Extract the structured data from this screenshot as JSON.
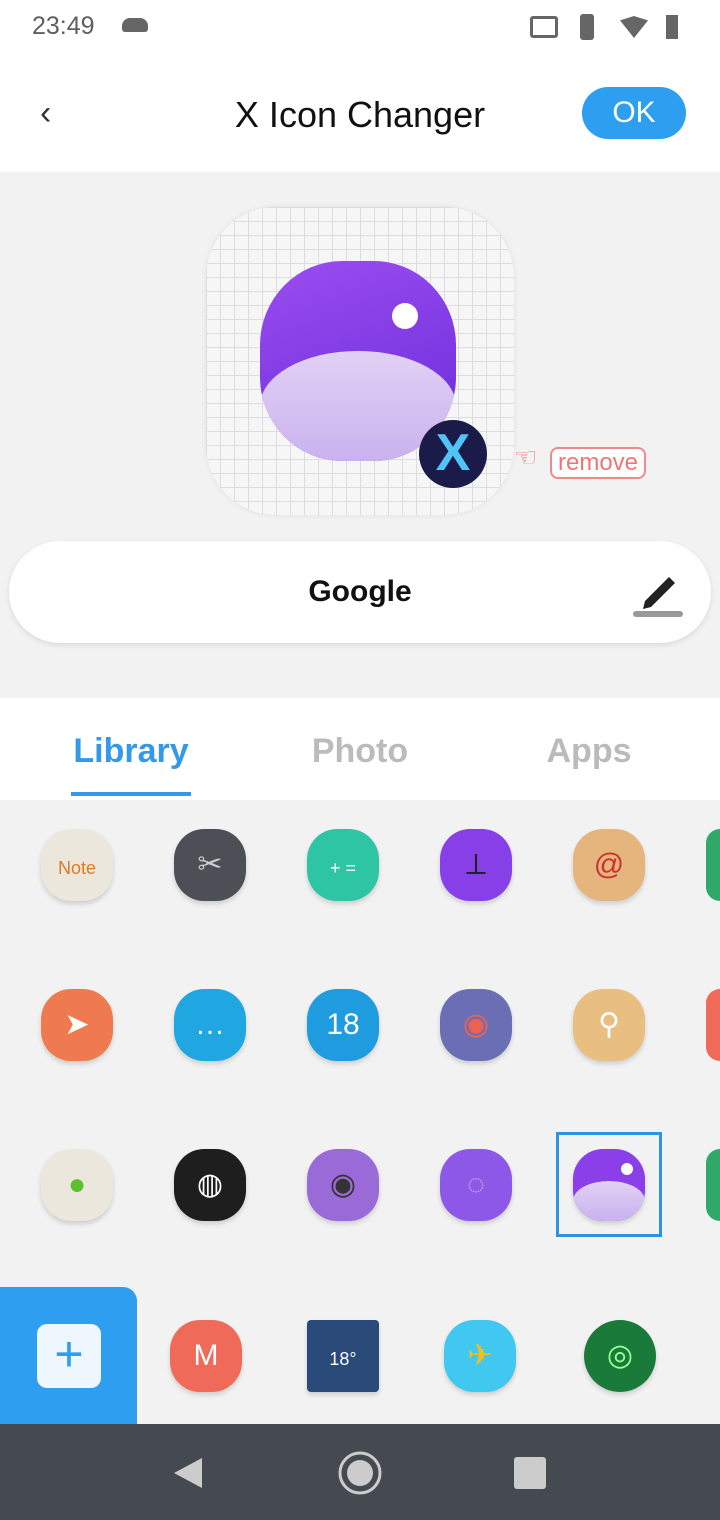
{
  "status": {
    "time": "23:49",
    "icons": [
      "cloud-icon",
      "cast-icon",
      "vibrate-icon",
      "wifi-icon",
      "battery-icon"
    ]
  },
  "header": {
    "title": "X Icon Changer",
    "ok_label": "OK",
    "back_icon": "‹"
  },
  "preview": {
    "remove_label": "remove",
    "badge": "X"
  },
  "name_field": {
    "value": "Google"
  },
  "tabs": [
    {
      "label": "Library",
      "active": true
    },
    {
      "label": "Photo",
      "active": false
    },
    {
      "label": "Apps",
      "active": false
    }
  ],
  "icons": [
    {
      "name": "note",
      "bg": "#ebe7dc",
      "fg": "#e07a20",
      "text": "Note"
    },
    {
      "name": "video-editor",
      "bg": "#4c5056",
      "fg": "#ccc",
      "text": "✂"
    },
    {
      "name": "calculator",
      "bg": "#2ec5a4",
      "fg": "#fff",
      "text": "+ ="
    },
    {
      "name": "clock",
      "bg": "#8740e8",
      "fg": "#222",
      "text": "⟂"
    },
    {
      "name": "email",
      "bg": "#e4b57c",
      "fg": "#d03030",
      "text": "@"
    },
    {
      "name": "send",
      "bg": "#f07a50",
      "fg": "#fff",
      "text": "➤"
    },
    {
      "name": "messages",
      "bg": "#20a6e0",
      "fg": "#fff",
      "text": "…"
    },
    {
      "name": "calendar",
      "bg": "#1f9be0",
      "fg": "#fff",
      "text": "18"
    },
    {
      "name": "compass",
      "bg": "#6a6fb5",
      "fg": "#f06050",
      "text": "◉"
    },
    {
      "name": "files",
      "bg": "#e8bf80",
      "fg": "#fff",
      "text": "⚲"
    },
    {
      "name": "android",
      "bg": "#ebe7dc",
      "fg": "#5cc030",
      "text": "●"
    },
    {
      "name": "browser",
      "bg": "#1e1e1e",
      "fg": "#fff",
      "text": "◍"
    },
    {
      "name": "camera",
      "bg": "#9a6ad8",
      "fg": "#333",
      "text": "◉"
    },
    {
      "name": "chat",
      "bg": "#8d58e8",
      "fg": "#c9b2ee",
      "text": "◌"
    },
    {
      "name": "gallery",
      "bg": "#8a3fe8",
      "fg": "#fff",
      "text": ""
    },
    {
      "name": "music",
      "bg": "#f06a5a",
      "fg": "#fff",
      "text": "M"
    },
    {
      "name": "weather",
      "bg": "#2a4a7a",
      "fg": "#fff",
      "text": "18°"
    },
    {
      "name": "game",
      "bg": "#40c8f0",
      "fg": "#f0c020",
      "text": "✈"
    },
    {
      "name": "photo-camera",
      "bg": "#1a7a3a",
      "fg": "#9f9",
      "text": "◎"
    }
  ],
  "colors": {
    "accent": "#2e9ef0",
    "remove": "#f07575"
  }
}
